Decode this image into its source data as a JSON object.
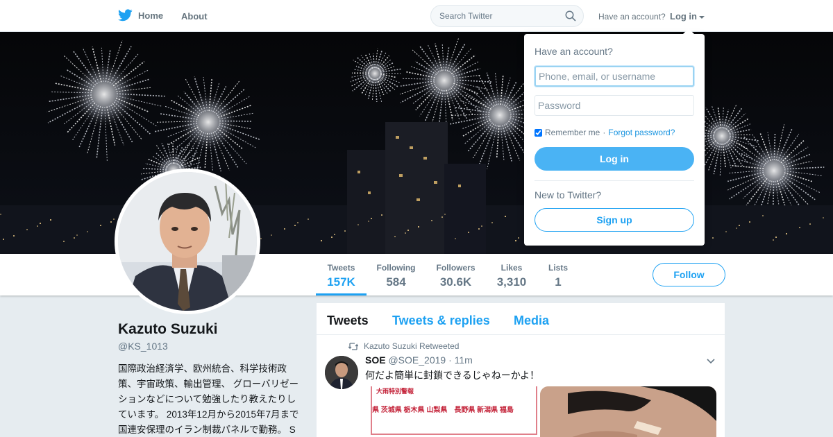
{
  "nav": {
    "home_label": "Home",
    "about_label": "About",
    "search_placeholder": "Search Twitter",
    "have_account": "Have an account?",
    "login_label": "Log in"
  },
  "profile": {
    "name": "Kazuto Suzuki",
    "handle": "@KS_1013",
    "bio": "国際政治経済学、欧州統合、科学技術政策、宇宙政策、輸出管理、 グローバリゼーションなどについて勉強したり教えたりしています。 2013年12月から2015年7月まで国連安保理のイラン制裁パネルで勤務。 Sorry folks, all tweets are in"
  },
  "stats": [
    {
      "label": "Tweets",
      "value": "157K"
    },
    {
      "label": "Following",
      "value": "584"
    },
    {
      "label": "Followers",
      "value": "30.6K"
    },
    {
      "label": "Likes",
      "value": "3,310"
    },
    {
      "label": "Lists",
      "value": "1"
    }
  ],
  "follow_label": "Follow",
  "timeline": {
    "tabs": [
      "Tweets",
      "Tweets & replies",
      "Media"
    ],
    "tweet": {
      "retweet_context": "Kazuto Suzuki Retweeted",
      "author_name": "SOE",
      "author_handle": "@SOE_2019",
      "time": "· 11m",
      "text": "何だよ簡単に封鎖できるじゃねーかよ！",
      "image_header": "大雨特別警報",
      "image_text": "県 茨城県 栃木県 山梨県　長野県 新潟県 福島"
    }
  },
  "login_dropdown": {
    "title": "Have an account?",
    "username_placeholder": "Phone, email, or username",
    "password_placeholder": "Password",
    "remember_label": "Remember me",
    "separator": "·",
    "forgot_label": "Forgot password?",
    "login_button": "Log in",
    "new_label": "New to Twitter?",
    "signup_button": "Sign up"
  },
  "colors": {
    "accent": "#1da1f2",
    "login_button": "#4ab3f4",
    "background": "#e6ecf0"
  }
}
